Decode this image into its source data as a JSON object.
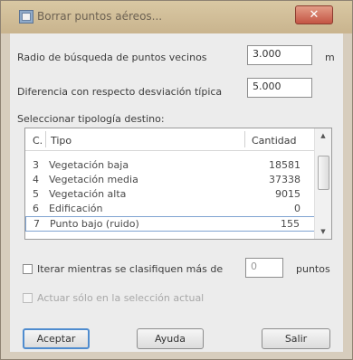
{
  "window": {
    "title": "Borrar puntos aéreos...",
    "close_glyph": "✕"
  },
  "radius": {
    "label": "Radio de búsqueda de puntos vecinos",
    "value": "3.000",
    "unit": "m"
  },
  "stddev": {
    "label": "Diferencia con respecto desviación típica",
    "value": "5.000"
  },
  "typology": {
    "label": "Seleccionar tipología destino:",
    "columns": [
      "C.",
      "Tipo",
      "Cantidad"
    ],
    "rows": [
      {
        "code": "3",
        "tipo": "Vegetación baja",
        "cantidad": "18581"
      },
      {
        "code": "4",
        "tipo": "Vegetación media",
        "cantidad": "37338"
      },
      {
        "code": "5",
        "tipo": "Vegetación alta",
        "cantidad": "9015"
      },
      {
        "code": "6",
        "tipo": "Edificación",
        "cantidad": "0"
      },
      {
        "code": "7",
        "tipo": "Punto bajo (ruido)",
        "cantidad": "155"
      }
    ],
    "selected_index": 4
  },
  "iterate": {
    "label": "Iterar mientras se clasifiquen más de",
    "value": "0",
    "suffix": "puntos",
    "checked": false
  },
  "selection_only": {
    "label": "Actuar sólo en la selección actual",
    "checked": false,
    "enabled": false
  },
  "buttons": {
    "accept": "Aceptar",
    "help": "Ayuda",
    "exit": "Salir"
  }
}
